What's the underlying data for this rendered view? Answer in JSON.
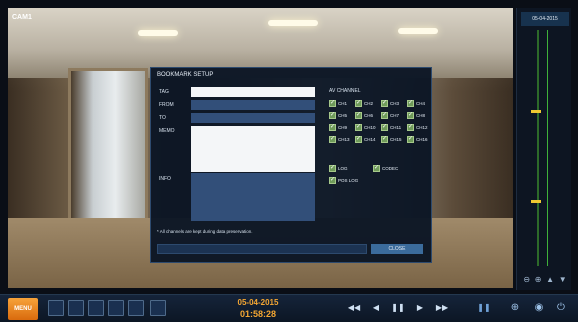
{
  "camera": {
    "label": "CAM1"
  },
  "timeline": {
    "date": "05-04-2015"
  },
  "dialog": {
    "title": "BOOKMARK SETUP",
    "labels": {
      "tag": "TAG",
      "from": "FROM",
      "to": "TO",
      "memo": "MEMO",
      "info": "INFO"
    },
    "av_channel_title": "AV CHANNEL",
    "channels": [
      "CH1",
      "CH2",
      "CH3",
      "CH4",
      "CH5",
      "CH6",
      "CH7",
      "CH8",
      "CH9",
      "CH10",
      "CH11",
      "CH12",
      "CH13",
      "CH14",
      "CH15",
      "CH16"
    ],
    "options": {
      "log": "LOG",
      "codec": "CODEC",
      "pos_log": "POS LOG"
    },
    "note": "* All channels are kept during data preservation.",
    "close_label": "CLOSE"
  },
  "bottom_bar": {
    "menu_label": "MENU",
    "date": "05-04-2015",
    "time": "01:58:28"
  },
  "colors": {
    "accent": "#f5a733",
    "panel": "#0a1424",
    "field": "#324f79"
  }
}
